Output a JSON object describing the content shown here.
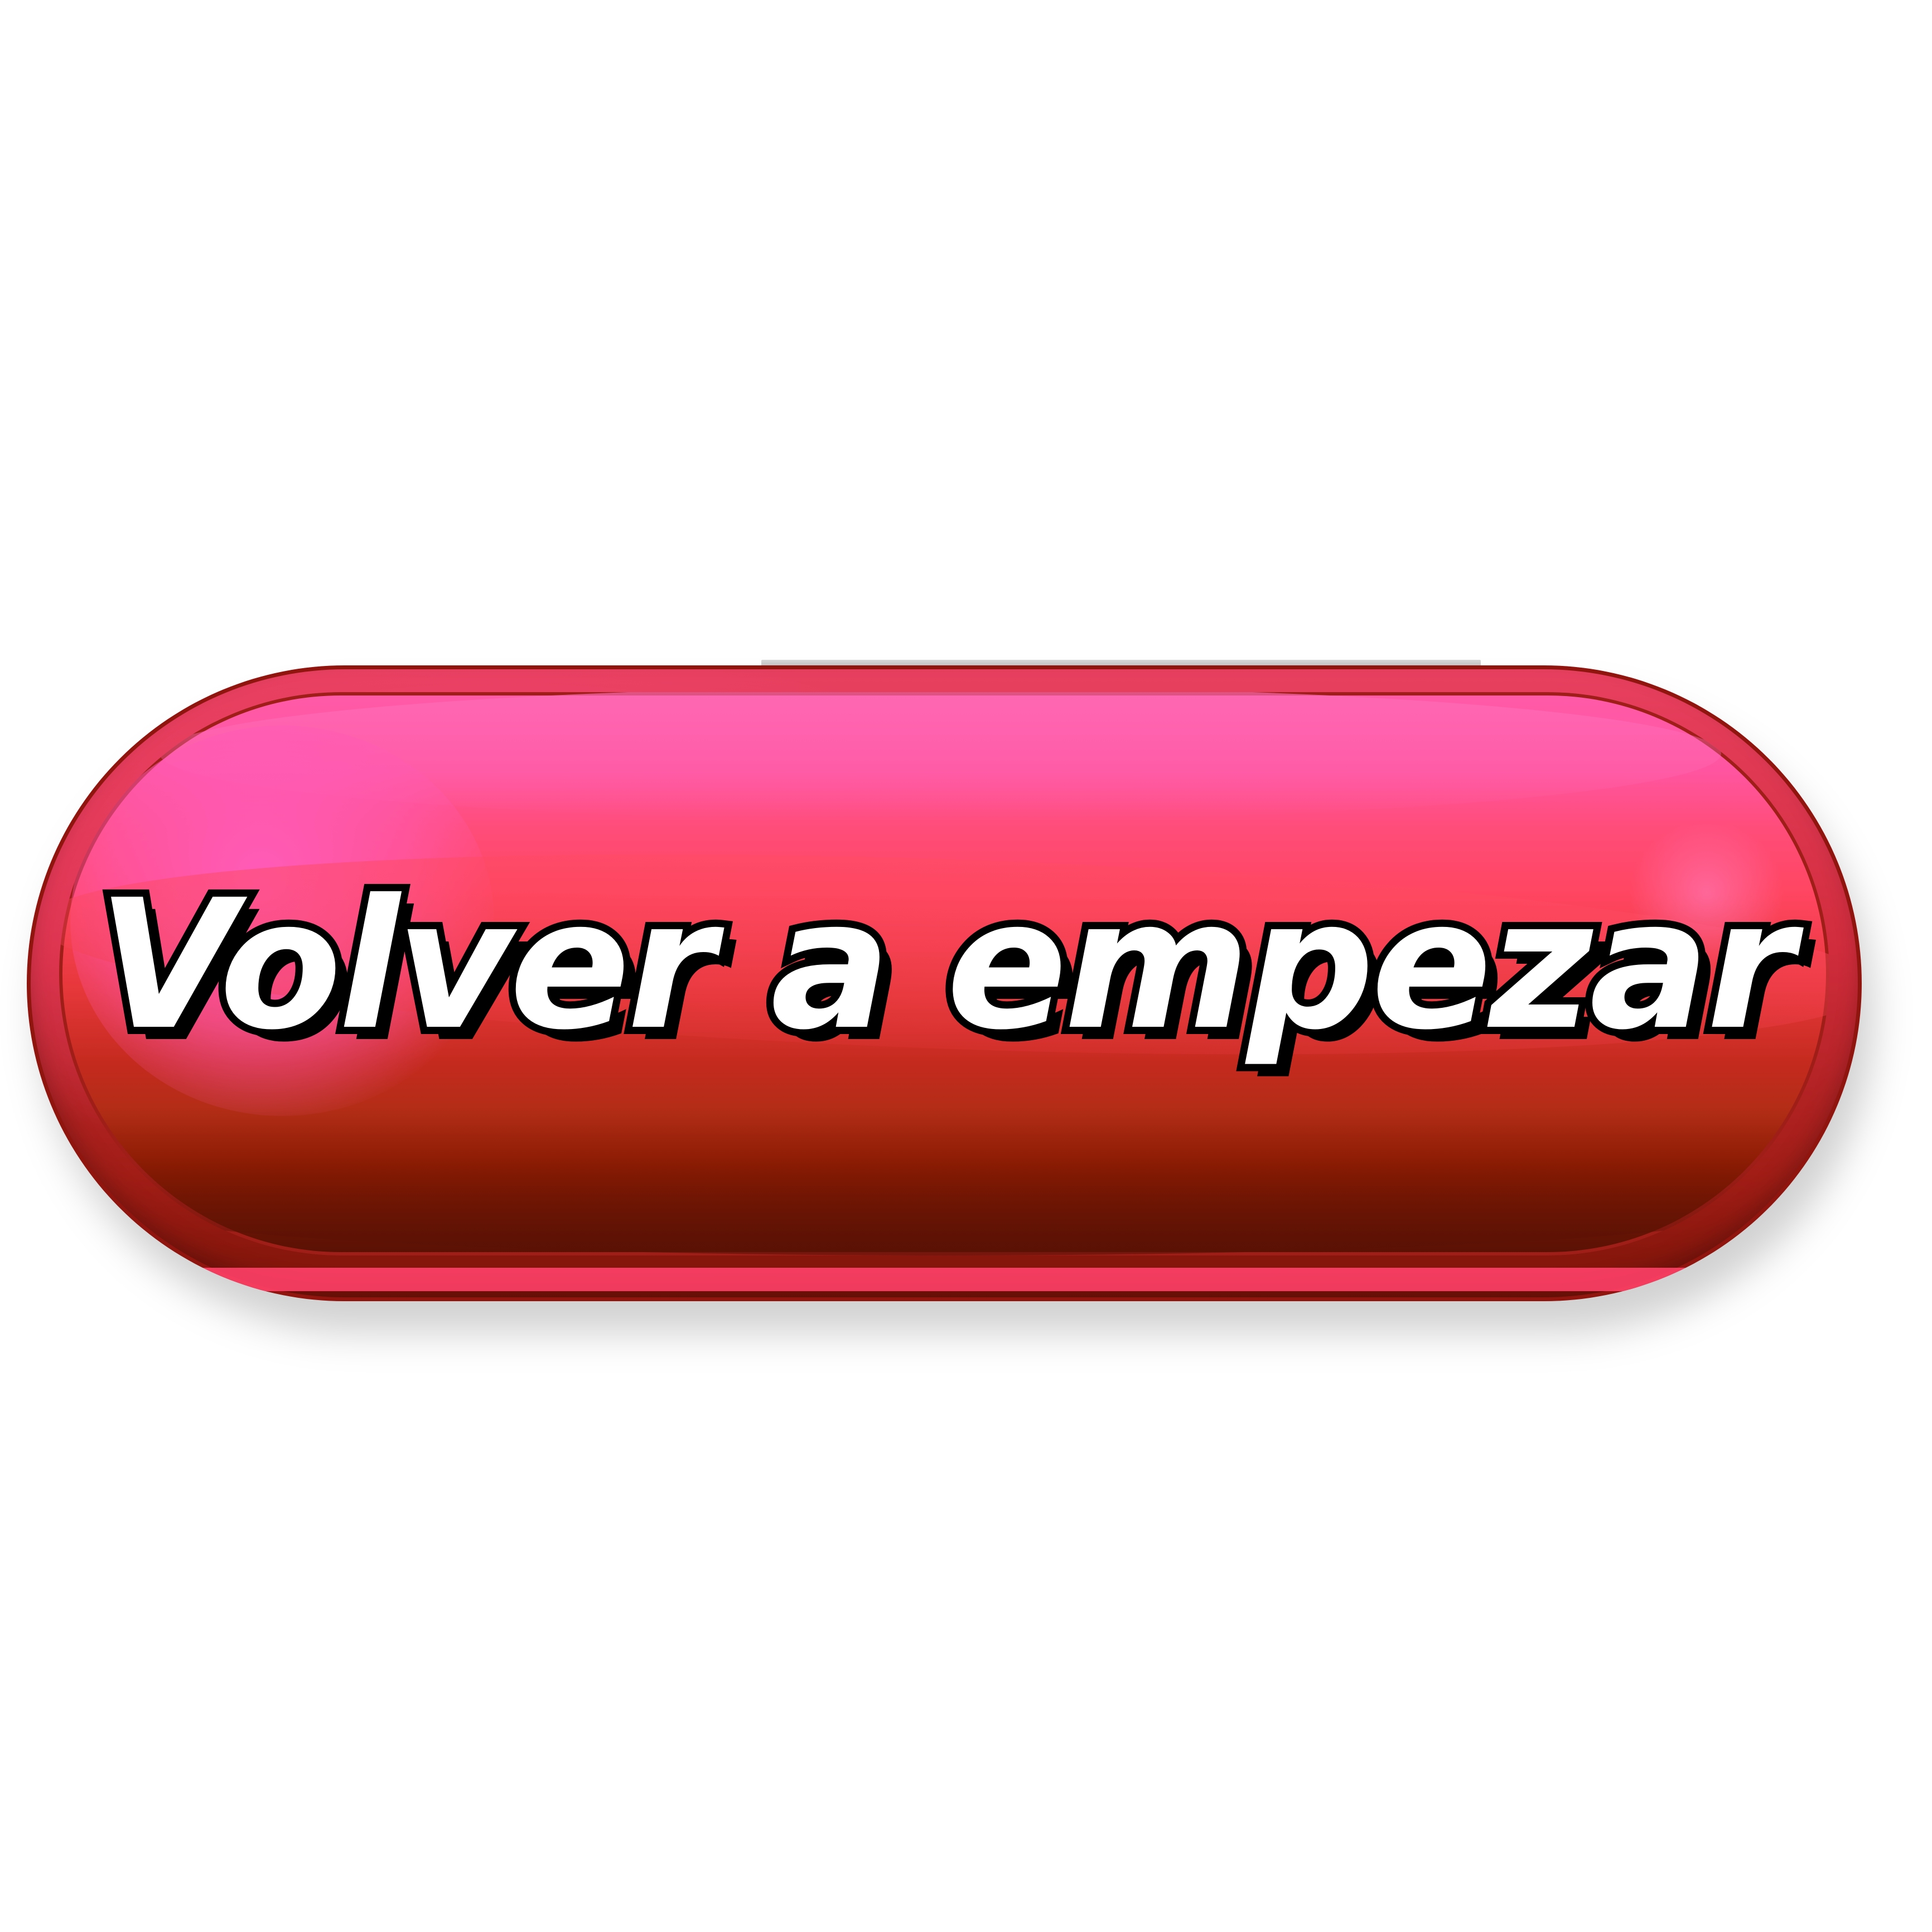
{
  "button": {
    "label": "Volver a empezar"
  },
  "colors": {
    "background": "#ffffff",
    "button_top": "#ff5aa8",
    "button_mid": "#ff4560",
    "button_bottom": "#8a1b03",
    "rim": "#8f150e",
    "label_fill": "#ffffff",
    "label_outline": "#000000"
  }
}
